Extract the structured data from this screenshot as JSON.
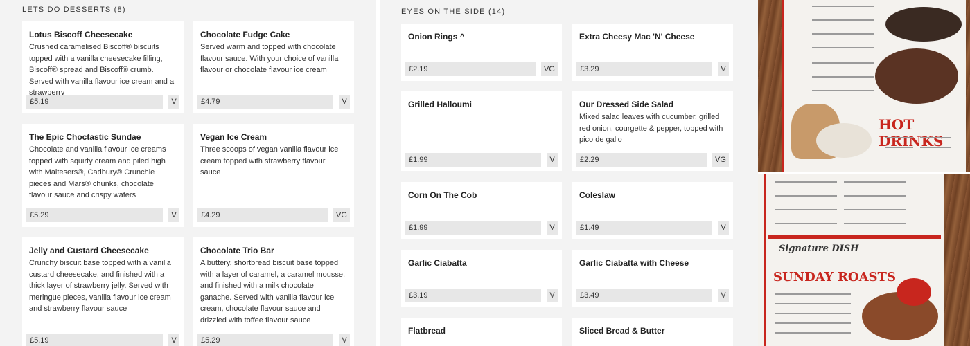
{
  "desserts": {
    "title": "LETS DO DESSERTS (8)",
    "items": [
      {
        "name": "Lotus Biscoff Cheesecake",
        "desc": "Crushed caramelised Biscoff® biscuits topped with a vanilla cheesecake filling, Biscoff® spread and Biscoff® crumb. Served with vanilla flavour ice cream and a strawberry",
        "price": "£5.19",
        "diet": "V"
      },
      {
        "name": "Chocolate Fudge Cake",
        "desc": "Served warm and topped with chocolate flavour sauce. With your choice of vanilla flavour or chocolate flavour ice cream",
        "price": "£4.79",
        "diet": "V"
      },
      {
        "name": "The Epic Choctastic Sundae",
        "desc": "Chocolate and vanilla flavour ice creams topped with squirty cream and piled high with Maltesers®, Cadbury® Crunchie pieces and Mars® chunks, chocolate flavour sauce and crispy wafers",
        "price": "£5.29",
        "diet": "V"
      },
      {
        "name": "Vegan Ice Cream",
        "desc": "Three scoops of vegan vanilla flavour ice cream topped with strawberry flavour sauce",
        "price": "£4.29",
        "diet": "VG"
      },
      {
        "name": "Jelly and Custard Cheesecake",
        "desc": "Crunchy biscuit base topped with a vanilla custard cheesecake, and finished with a thick layer of strawberry jelly. Served with meringue pieces, vanilla flavour ice cream and strawberry flavour sauce",
        "price": "£5.19",
        "diet": "V"
      },
      {
        "name": "Chocolate Trio Bar",
        "desc": "A buttery, shortbread biscuit base topped with a layer of caramel, a caramel mousse, and finished with a milk chocolate ganache. Served with vanilla flavour ice cream, chocolate flavour sauce and drizzled with toffee flavour sauce",
        "price": "£5.29",
        "diet": "V"
      }
    ]
  },
  "sides": {
    "title": "EYES ON THE SIDE (14)",
    "items": [
      {
        "name": "Onion Rings ^",
        "desc": "",
        "price": "£2.19",
        "diet": "VG"
      },
      {
        "name": "Extra Cheesy Mac 'N' Cheese",
        "desc": "",
        "price": "£3.29",
        "diet": "V"
      },
      {
        "name": "Grilled Halloumi",
        "desc": "",
        "price": "£1.99",
        "diet": "V"
      },
      {
        "name": "Our Dressed Side Salad",
        "desc": "Mixed salad leaves with cucumber, grilled red onion, courgette & pepper, topped with pico de gallo",
        "price": "£2.29",
        "diet": "VG"
      },
      {
        "name": "Corn On The Cob",
        "desc": "",
        "price": "£1.99",
        "diet": "V"
      },
      {
        "name": "Coleslaw",
        "desc": "",
        "price": "£1.49",
        "diet": "V"
      },
      {
        "name": "Garlic Ciabatta",
        "desc": "",
        "price": "£3.19",
        "diet": "V"
      },
      {
        "name": "Garlic Ciabatta with Cheese",
        "desc": "",
        "price": "£3.49",
        "diet": "V"
      },
      {
        "name": "Flatbread",
        "desc": "",
        "price": "",
        "diet": ""
      },
      {
        "name": "Sliced Bread & Butter",
        "desc": "",
        "price": "",
        "diet": ""
      }
    ]
  },
  "photos": {
    "top": {
      "heading": "HOT DRINKS"
    },
    "bottom": {
      "heading": "SUNDAY ROASTS",
      "subheading": "Signature DISH"
    }
  }
}
